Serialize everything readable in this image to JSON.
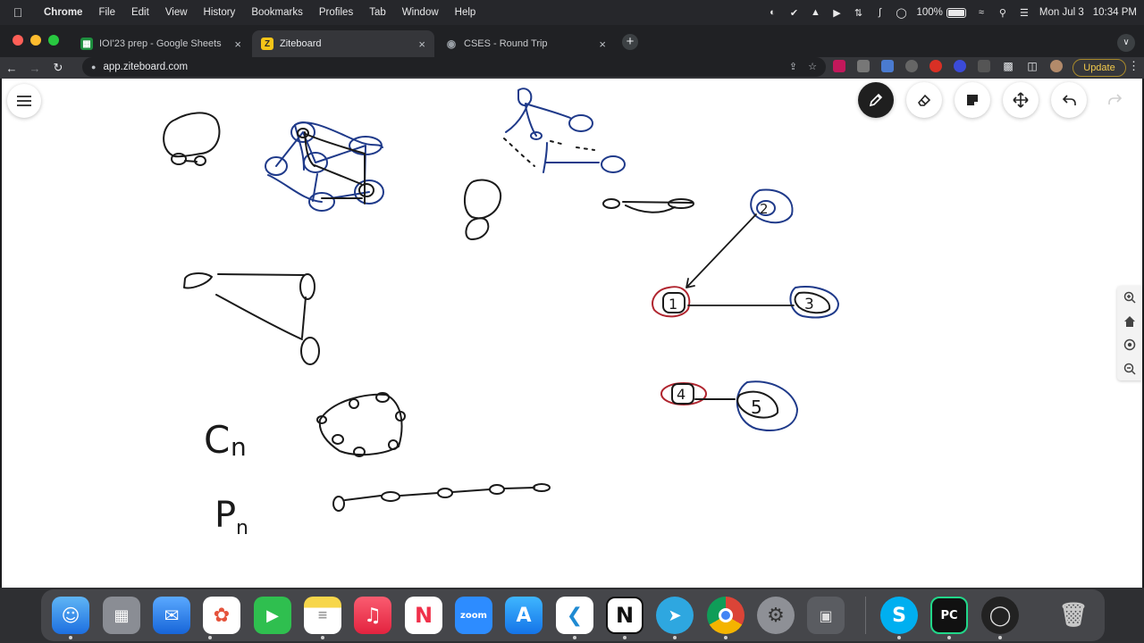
{
  "menubar": {
    "app_name": "Chrome",
    "items": [
      "File",
      "Edit",
      "View",
      "History",
      "Bookmarks",
      "Profiles",
      "Tab",
      "Window",
      "Help"
    ],
    "battery": "100%",
    "date": "Mon Jul 3",
    "time": "10:34 PM"
  },
  "tabs": [
    {
      "label": "IOI'23 prep - Google Sheets",
      "icon": "google-sheets-icon",
      "color": "#1e8e3e"
    },
    {
      "label": "Ziteboard",
      "icon": "ziteboard-icon",
      "color": "#f5c518",
      "glyph": "Z"
    },
    {
      "label": "CSES - Round Trip",
      "icon": "globe-icon",
      "color": "#9aa0a6"
    }
  ],
  "toolbar": {
    "url": "app.ziteboard.com",
    "update_label": "Update"
  },
  "board": {
    "labels": {
      "cycle": "C",
      "cycle_sub": "n",
      "path": "P",
      "path_sub": "n",
      "n1": "1",
      "n2": "2",
      "n3": "3",
      "n4": "4",
      "n5": "5"
    },
    "ink_colors": {
      "black": "#1a1a1a",
      "blue": "#1f3a8a",
      "red": "#b0252f"
    }
  },
  "dock": [
    "finder",
    "launchpad",
    "mail",
    "photos",
    "facetime",
    "notes",
    "music",
    "news",
    "zoom",
    "app-store",
    "vscode",
    "notion",
    "telegram",
    "chrome",
    "system-settings",
    "screenshot",
    "skype",
    "pycharm",
    "obs",
    "trash"
  ]
}
